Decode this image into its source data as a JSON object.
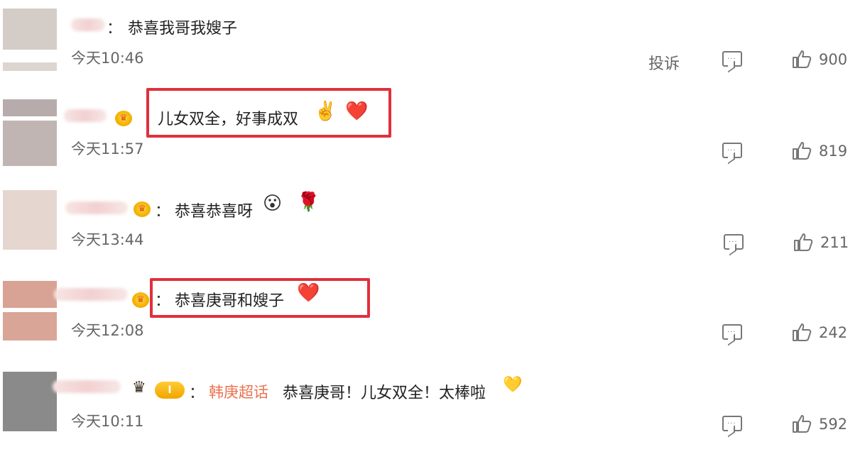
{
  "comments": [
    {
      "text": "恭喜我哥我嫂子",
      "time": "今天10:46",
      "report_label": "投诉",
      "likes": "900"
    },
    {
      "text": "儿女双全，好事成双",
      "emojis": [
        "✌️",
        "❤️"
      ],
      "time": "今天11:57",
      "likes": "819"
    },
    {
      "text": "恭喜恭喜呀",
      "emojis": [
        "😮",
        "🌹"
      ],
      "time": "今天13:44",
      "likes": "211"
    },
    {
      "text": "恭喜庚哥和嫂子",
      "emojis": [
        "❤️"
      ],
      "time": "今天12:08",
      "likes": "242"
    },
    {
      "badge_level": "I",
      "topic": "韩庚超话",
      "text": "恭喜庚哥！儿女双全！太棒啦",
      "emojis": [
        "💛"
      ],
      "time": "今天10:11",
      "likes": "592"
    }
  ],
  "colon": "：",
  "colors": {
    "highlight": "#e0303c",
    "topic": "#eb7350"
  },
  "icons": {
    "reply": "comment-icon",
    "like": "thumbs-up-icon",
    "member": "crown-icon"
  }
}
